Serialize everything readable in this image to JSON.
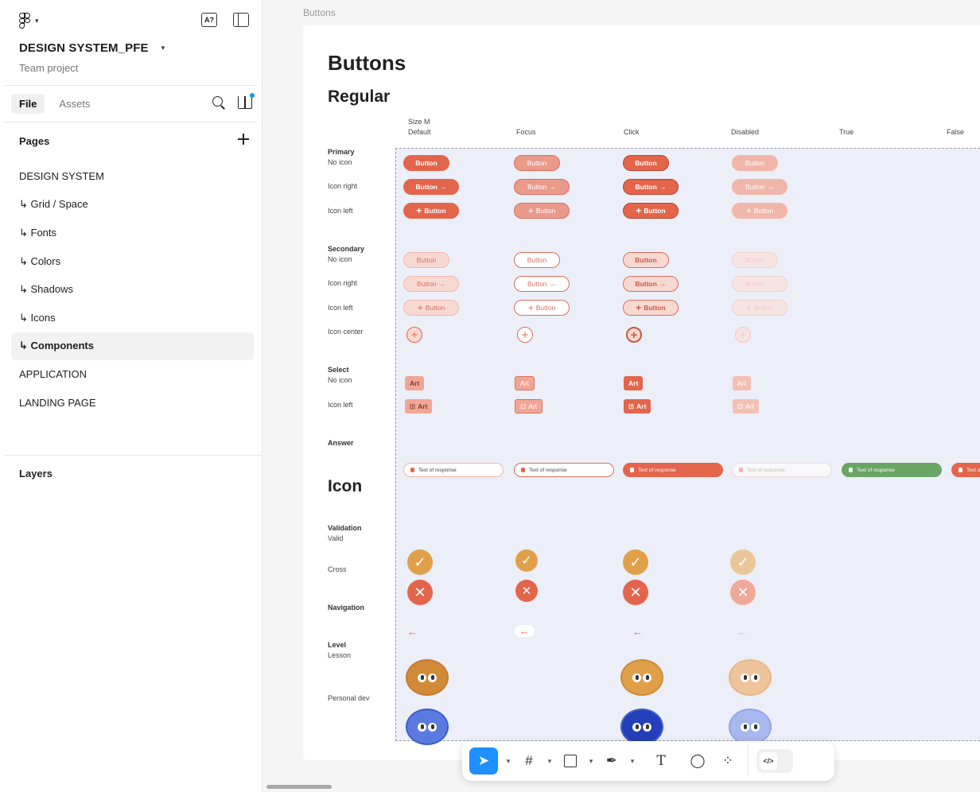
{
  "sidebar": {
    "project_name": "DESIGN SYSTEM_PFE",
    "project_sub": "Team project",
    "ai_badge": "A?",
    "tabs": [
      {
        "label": "File"
      },
      {
        "label": "Assets"
      }
    ],
    "pages_header": "Pages",
    "pages": [
      {
        "label": "DESIGN SYSTEM"
      },
      {
        "label": "↳ Grid / Space"
      },
      {
        "label": "↳ Fonts"
      },
      {
        "label": "↳ Colors"
      },
      {
        "label": "↳ Shadows"
      },
      {
        "label": "↳ Icons"
      },
      {
        "label": "↳ Components"
      },
      {
        "label": "APPLICATION"
      },
      {
        "label": "LANDING PAGE"
      }
    ],
    "layers_header": "Layers"
  },
  "canvas": {
    "frame_label": "Buttons",
    "title": "Buttons",
    "subtitle": "Regular",
    "icon_title": "Icon",
    "size_label": "Size M",
    "columns": [
      "Default",
      "Focus",
      "Click",
      "Disabled",
      "True",
      "False"
    ],
    "rows": {
      "primary": "Primary",
      "no_icon": "No icon",
      "icon_right": "Icon right",
      "icon_left": "Icon left",
      "secondary": "Secondary",
      "icon_center": "Icon center",
      "select": "Select",
      "answer": "Answer",
      "validation": "Validation",
      "valid": "Valid",
      "cross": "Cross",
      "navigation": "Navigation",
      "level": "Level",
      "lesson": "Lesson",
      "personal_dev": "Personal dev"
    },
    "button_label": "Button",
    "select_label": "Art",
    "answer_label": "Text of response"
  },
  "colors": {
    "primary": "#e3654b",
    "true": "#6aa566",
    "validation": "#e0a04a",
    "level": "#d08a38",
    "personal": "#3f5fcf"
  }
}
